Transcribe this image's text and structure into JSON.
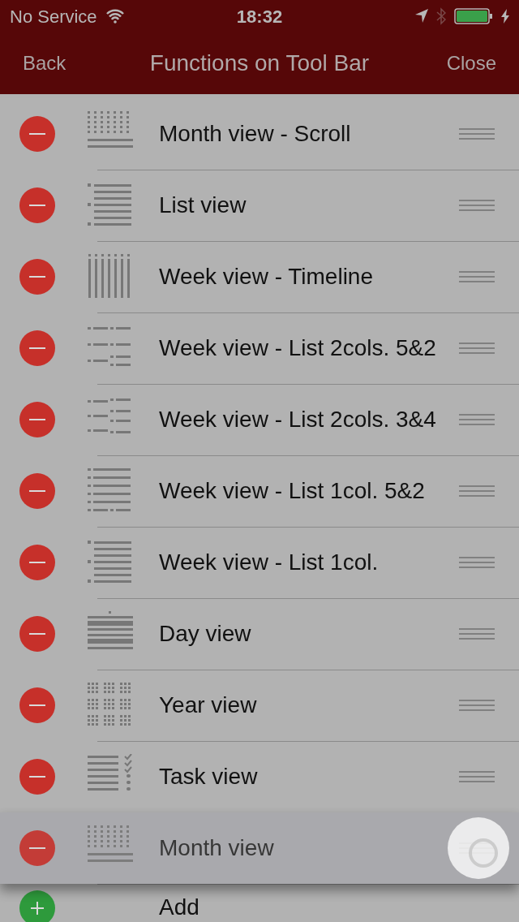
{
  "status_bar": {
    "carrier": "No Service",
    "time": "18:32"
  },
  "nav_bar": {
    "back": "Back",
    "title": "Functions on Tool Bar",
    "close": "Close"
  },
  "rows": [
    {
      "kind": "remove",
      "label": "Month view - Scroll",
      "dragging": false
    },
    {
      "kind": "remove",
      "label": "List view",
      "dragging": false
    },
    {
      "kind": "remove",
      "label": "Week view - Timeline",
      "dragging": false
    },
    {
      "kind": "remove",
      "label": "Week view - List 2cols. 5&2",
      "dragging": false
    },
    {
      "kind": "remove",
      "label": "Week view - List 2cols. 3&4",
      "dragging": false
    },
    {
      "kind": "remove",
      "label": "Week view - List 1col. 5&2",
      "dragging": false
    },
    {
      "kind": "remove",
      "label": "Week view - List 1col.",
      "dragging": false
    },
    {
      "kind": "remove",
      "label": "Day view",
      "dragging": false
    },
    {
      "kind": "remove",
      "label": "Year view",
      "dragging": false
    },
    {
      "kind": "remove",
      "label": "Task view",
      "dragging": false
    },
    {
      "kind": "remove",
      "label": "Month view",
      "dragging": true
    },
    {
      "kind": "add",
      "label": "Add",
      "dragging": false
    }
  ]
}
